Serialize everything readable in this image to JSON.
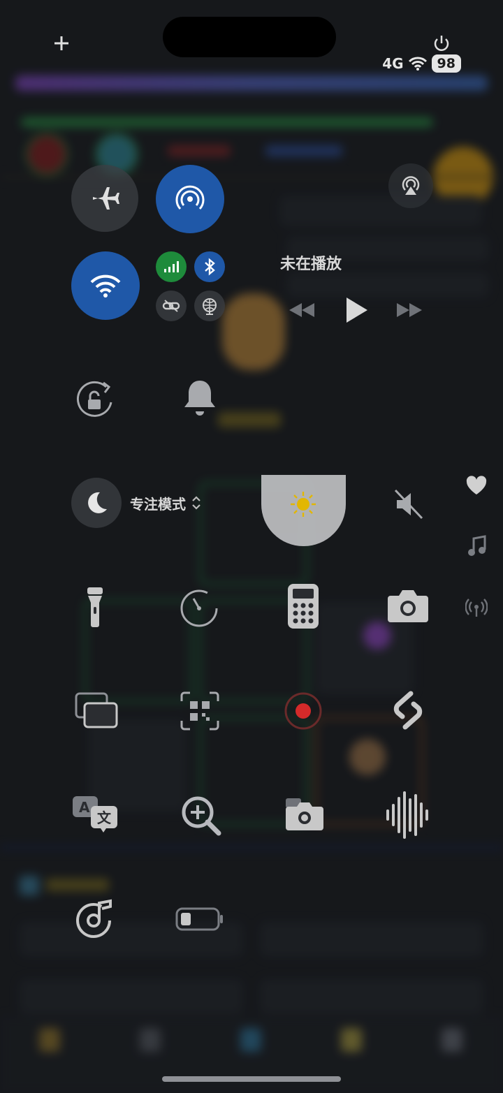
{
  "status_bar": {
    "battery_level": "98",
    "signal_text": "4G"
  },
  "control_center": {
    "now_playing": "未在播放",
    "focus_label": "专注模式",
    "focus_chevron": "⌃⌄"
  },
  "icons": [
    "plus-icon",
    "power-icon",
    "airplane-icon",
    "airdrop-icon",
    "wifi-icon",
    "cellular-icon",
    "bluetooth-icon",
    "link-icon",
    "globe-icon",
    "airplay-icon",
    "rewind-icon",
    "play-icon",
    "forward-icon",
    "rotation-lock-icon",
    "bell-icon",
    "moon-icon",
    "sun-icon",
    "mute-icon",
    "heart-icon",
    "music-note-icon",
    "broadcast-icon",
    "flashlight-icon",
    "timer-icon",
    "calculator-icon",
    "camera-icon",
    "screen-mirroring-icon",
    "qr-code-icon",
    "screen-record-icon",
    "shazam-icon",
    "translate-icon",
    "magnifier-icon",
    "camera-small-icon",
    "voice-memo-icon",
    "music-recognition-icon",
    "low-power-battery-icon"
  ],
  "colors": {
    "accent_blue": "#1f58a8",
    "accent_green": "#1e8b3b",
    "record_red": "#d42a2a",
    "sun_yellow": "#f4c400"
  }
}
